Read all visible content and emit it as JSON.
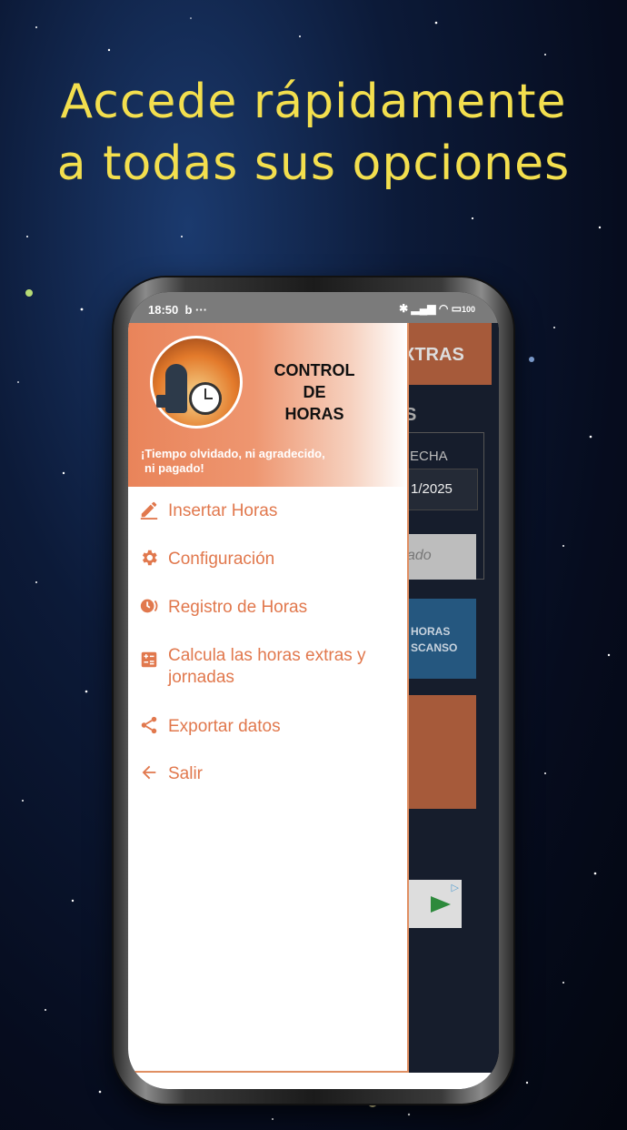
{
  "headline": {
    "line1": "Accede rápidamente",
    "line2": "a todas sus opciones"
  },
  "status_bar": {
    "time": "18:50",
    "extra": "b ···",
    "battery": "100"
  },
  "background_app": {
    "header_text": "XTRAS",
    "section_fragment": "S",
    "date_label_fragment": "ECHA",
    "date_value_fragment": "1/2025",
    "field_fragment": "ado",
    "button_fragment_1": "HORAS",
    "button_fragment_2": "SCANSO"
  },
  "drawer": {
    "app_title_1": "CONTROL",
    "app_title_2": "DE",
    "app_title_3": "HORAS",
    "slogan_1": "¡Tiempo olvidado, ni agradecido,",
    "slogan_2": "ni pagado!",
    "accent_color": "#e1784d",
    "menu_items": [
      {
        "label": "Insertar Horas",
        "icon": "pencil-icon"
      },
      {
        "label": "Configuración",
        "icon": "gear-icon"
      },
      {
        "label": "Registro de Horas",
        "icon": "history-icon"
      },
      {
        "label": "Calcula las horas extras y",
        "label2": "jornadas",
        "icon": "calculator-icon"
      },
      {
        "label": "Exportar datos",
        "icon": "share-icon"
      },
      {
        "label": "Salir",
        "icon": "arrow-left-icon"
      }
    ]
  }
}
